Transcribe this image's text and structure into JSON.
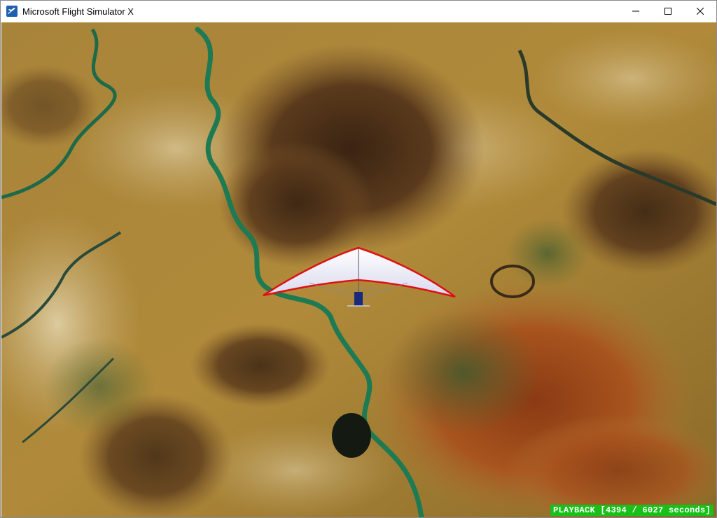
{
  "window": {
    "title": "Microsoft Flight Simulator X",
    "icon": "airplane-icon"
  },
  "controls": {
    "minimize": "minimize-icon",
    "maximize": "maximize-icon",
    "close": "close-icon"
  },
  "status": {
    "text": "PLAYBACK [4394 / 6027 seconds]"
  },
  "colors": {
    "status_bg": "#18c01a",
    "river": "#1e8a5a",
    "wing_edge": "#e01010"
  }
}
